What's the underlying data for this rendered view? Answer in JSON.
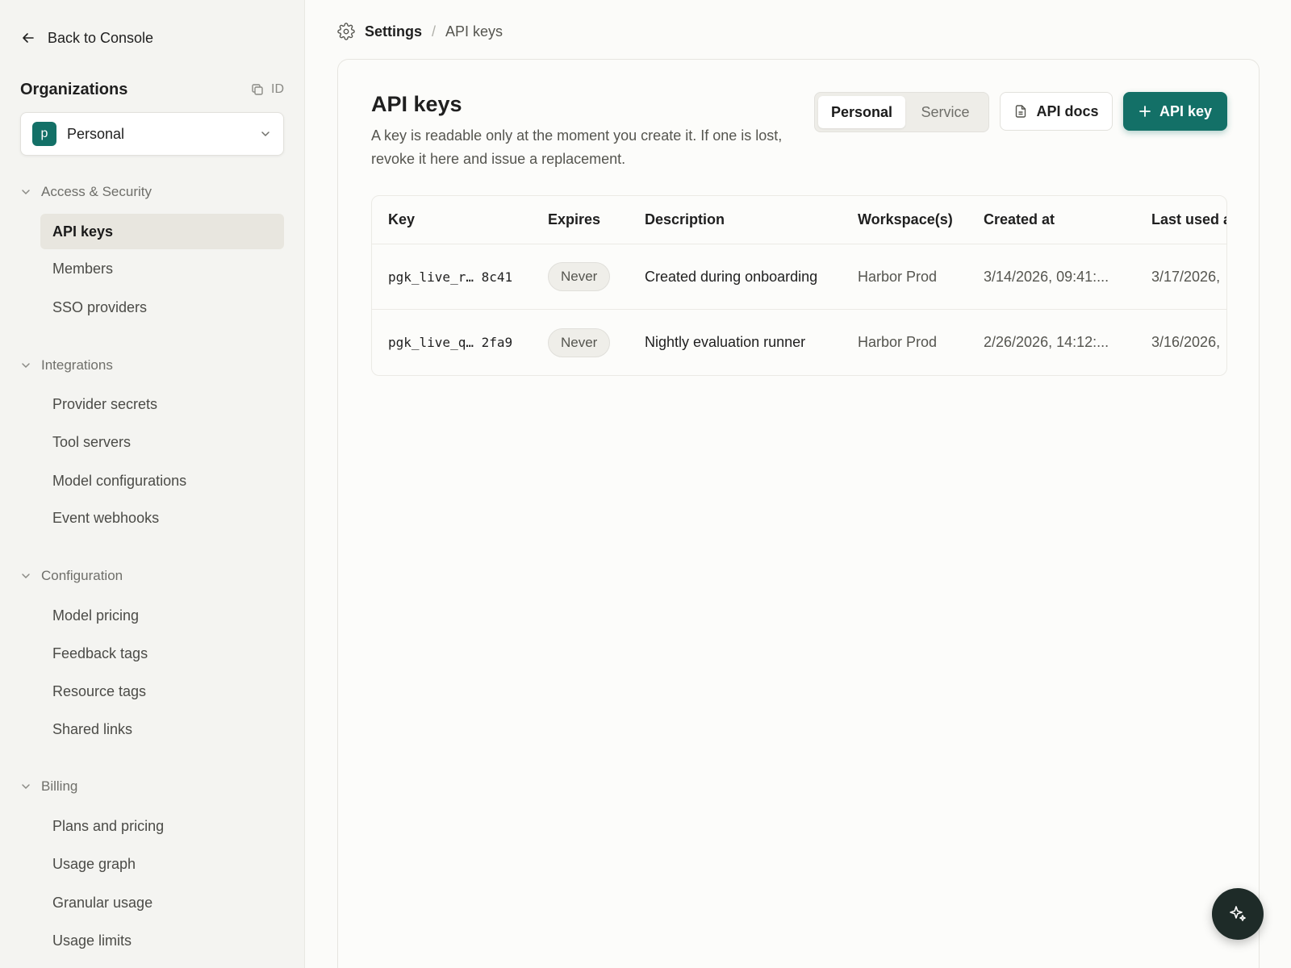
{
  "sidebar": {
    "back_label": "Back to Console",
    "org_title": "Organizations",
    "org_id_label": "ID",
    "org_avatar_letter": "p",
    "org_name": "Personal",
    "sections": [
      {
        "label": "Access & Security",
        "items": [
          {
            "label": "API keys",
            "active": true
          },
          {
            "label": "Members"
          },
          {
            "label": "SSO providers"
          }
        ]
      },
      {
        "label": "Integrations",
        "items": [
          {
            "label": "Provider secrets"
          },
          {
            "label": "Tool servers"
          },
          {
            "label": "Model configurations"
          },
          {
            "label": "Event webhooks"
          }
        ]
      },
      {
        "label": "Configuration",
        "items": [
          {
            "label": "Model pricing"
          },
          {
            "label": "Feedback tags"
          },
          {
            "label": "Resource tags"
          },
          {
            "label": "Shared links"
          }
        ]
      },
      {
        "label": "Billing",
        "items": [
          {
            "label": "Plans and pricing"
          },
          {
            "label": "Usage graph"
          },
          {
            "label": "Granular usage"
          },
          {
            "label": "Usage limits"
          }
        ]
      }
    ]
  },
  "breadcrumb": {
    "parent": "Settings",
    "separator": "/",
    "current": "API keys"
  },
  "main": {
    "title": "API keys",
    "description": "A key is readable only at the moment you create it. If one is lost, revoke it here and issue a replacement.",
    "tabs": [
      {
        "label": "Personal",
        "selected": true
      },
      {
        "label": "Service",
        "selected": false
      }
    ],
    "docs_button": "API docs",
    "add_button": "API key",
    "table": {
      "columns": [
        "Key",
        "Expires",
        "Description",
        "Workspace(s)",
        "Created at",
        "Last used a"
      ],
      "rows": [
        {
          "key": "pgk_live_r… 8c41",
          "expires": "Never",
          "description": "Created during onboarding",
          "workspace": "Harbor Prod",
          "created": "3/14/2026, 09:41:...",
          "last_used": "3/17/2026,"
        },
        {
          "key": "pgk_live_q… 2fa9",
          "expires": "Never",
          "description": "Nightly evaluation runner",
          "workspace": "Harbor Prod",
          "created": "2/26/2026, 14:12:...",
          "last_used": "3/16/2026,"
        }
      ]
    }
  },
  "colors": {
    "accent": "#137067",
    "sidebar_bg": "#f4f4f1",
    "page_bg": "#fbfbf9",
    "fab_bg": "#1e2b28"
  },
  "icons": {
    "back": "arrow-left-icon",
    "copy": "copy-icon",
    "chevron": "chevron-down-icon",
    "gear": "gear-icon",
    "doc": "document-icon",
    "plus": "plus-icon",
    "sparkle": "sparkle-icon"
  }
}
